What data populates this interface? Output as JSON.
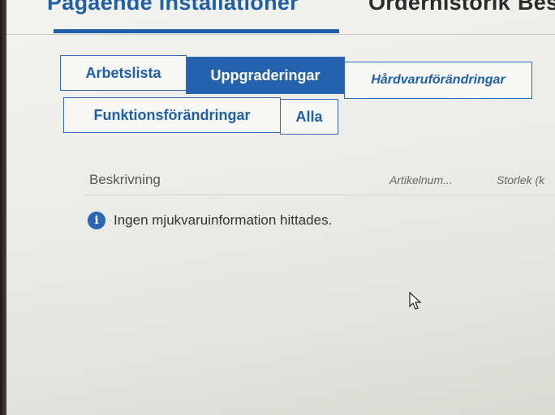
{
  "top_nav": {
    "active": "Pågående installationer",
    "order_history": "Orderhistorik",
    "third": "Bes"
  },
  "tabs": [
    {
      "label": "Arbetslista"
    },
    {
      "label": "Uppgraderingar",
      "selected": true
    },
    {
      "label": "Hårdvaruförändringar"
    },
    {
      "label": "Funktionsförändringar"
    },
    {
      "label": "Alla"
    }
  ],
  "table": {
    "columns": [
      "Beskrivning",
      "Artikelnum...",
      "Storlek (k"
    ],
    "empty_message": "Ingen mjukvaruinformation hittades."
  },
  "colors": {
    "accent": "#1f5fa8",
    "selected_tab_bg": "#2562ad",
    "info_icon": "#2a66b3"
  },
  "icons": {
    "info": "info-icon",
    "cursor": "mouse-pointer-icon"
  }
}
